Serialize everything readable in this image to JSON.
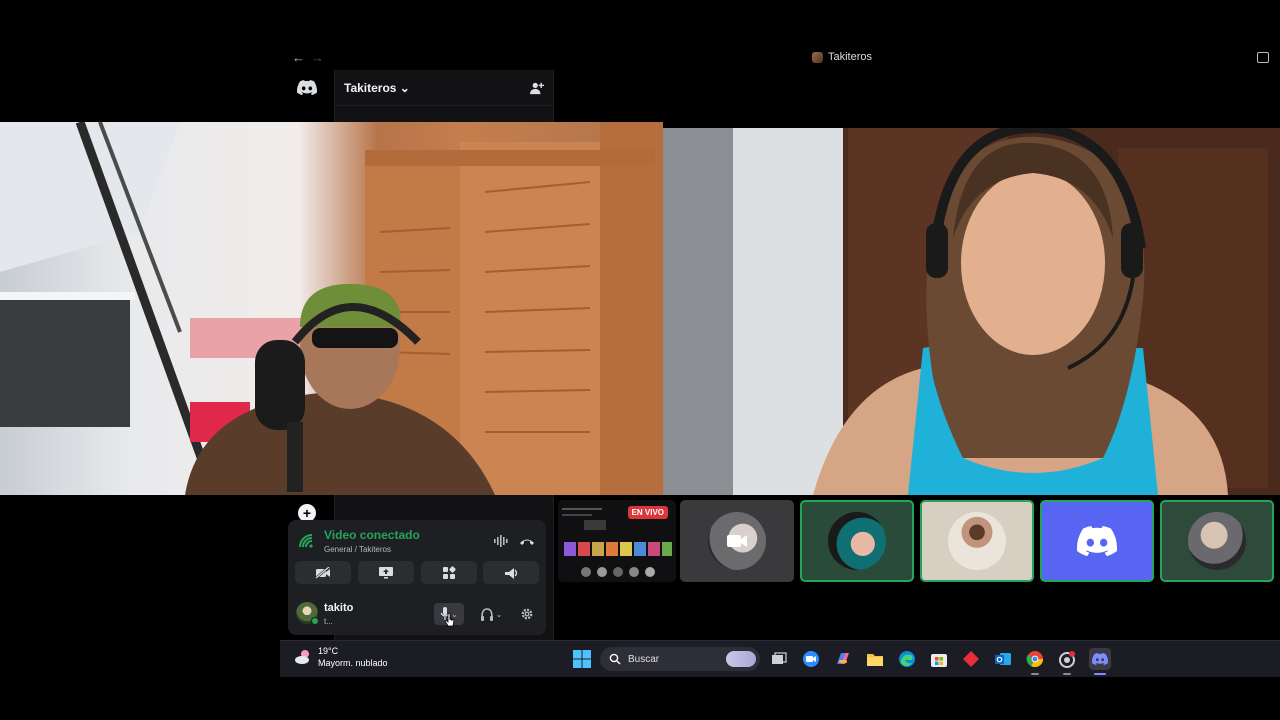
{
  "window": {
    "title": "Takiteros"
  },
  "server": {
    "name": "Takiteros"
  },
  "voice_panel": {
    "status": "Video conectado",
    "channel": "General / Takiteros",
    "user": {
      "name": "takito",
      "substatus": "t..."
    }
  },
  "participants": {
    "stream_badge": "EN VIVO",
    "tiles": [
      "stream-preview",
      "camera-off",
      "user-avatar",
      "user-avatar",
      "discord-default-avatar",
      "user-avatar"
    ]
  },
  "taskbar": {
    "weather_temp": "19°C",
    "weather_desc": "Mayorm. nublado",
    "search_placeholder": "Buscar",
    "apps": [
      "task-view",
      "zoom",
      "copilot",
      "file-explorer",
      "edge",
      "store",
      "app-red",
      "outlook",
      "chrome",
      "chrome-profile",
      "discord"
    ]
  },
  "colors": {
    "connected_green": "#23a55a",
    "blurple": "#5865f2",
    "live_red": "#da373c"
  }
}
